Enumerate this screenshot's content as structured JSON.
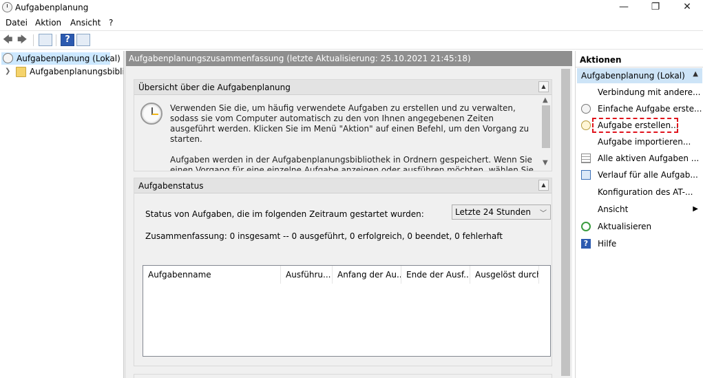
{
  "window": {
    "title": "Aufgabenplanung",
    "minimize": "—",
    "maximize": "❐",
    "close": "✕"
  },
  "menu": [
    "Datei",
    "Aktion",
    "Ansicht",
    "?"
  ],
  "toolbar": {
    "back": "🡄",
    "forward": "🡆",
    "help": "?"
  },
  "tree": {
    "root": "Aufgabenplanung (Lokal)",
    "child": "Aufgabenplanungsbibliothek"
  },
  "center": {
    "header": "Aufgabenplanungszusammenfassung (letzte Aktualisierung: 25.10.2021 21:45:18)",
    "overview": {
      "title": "Übersicht über die Aufgabenplanung",
      "para1": "Verwenden Sie die, um häufig verwendete Aufgaben zu erstellen und zu verwalten, sodass sie vom Computer automatisch zu den von Ihnen angegebenen Zeiten ausgeführt werden. Klicken Sie im Menü \"Aktion\" auf einen Befehl, um den Vorgang zu starten.",
      "para2": "Aufgaben werden in der Aufgabenplanungsbibliothek in Ordnern gespeichert. Wenn Sie einen Vorgang für eine einzelne Aufgabe anzeigen oder ausführen möchten, wählen Sie die Aufgabe in der Aufgabenplanungsbibliothek aus, und klicken Sie im Menü \"Aktion\" auf einen Befehl."
    },
    "status": {
      "title": "Aufgabenstatus",
      "label": "Status von Aufgaben, die im folgenden Zeitraum gestartet wurden:",
      "period": "Letzte 24 Stunden",
      "summary": "Zusammenfassung: 0 insgesamt -- 0 ausgeführt, 0 erfolgreich, 0 beendet, 0 fehlerhaft",
      "columns": [
        "Aufgabenname",
        "Ausführu...",
        "Anfang der Au...",
        "Ende der Ausf...",
        "Ausgelöst durch"
      ]
    }
  },
  "actions": {
    "title": "Aktionen",
    "group": "Aufgabenplanung (Lokal)",
    "items": [
      {
        "label": "Verbindung mit andere...",
        "icon": "none"
      },
      {
        "label": "Einfache Aufgabe erste...",
        "icon": "clock-icon"
      },
      {
        "label": "Aufgabe erstellen...",
        "icon": "clock-star-icon"
      },
      {
        "label": "Aufgabe importieren...",
        "icon": "none"
      },
      {
        "label": "Alle aktiven Aufgaben ...",
        "icon": "list-icon"
      },
      {
        "label": "Verlauf für alle Aufgab...",
        "icon": "grid-icon"
      },
      {
        "label": "Konfiguration des AT-...",
        "icon": "none"
      },
      {
        "label": "Ansicht",
        "icon": "none"
      },
      {
        "label": "Aktualisieren",
        "icon": "refresh-icon"
      },
      {
        "label": "Hilfe",
        "icon": "help-icon"
      }
    ],
    "highlight_color": "#e0121b"
  }
}
